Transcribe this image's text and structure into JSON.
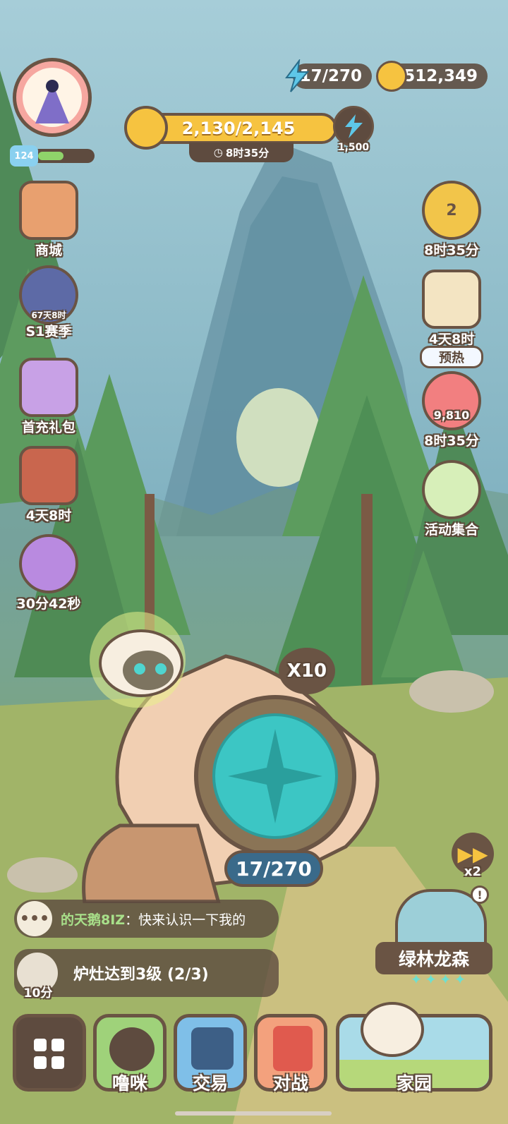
{
  "energy": {
    "value": "17/270"
  },
  "coins": {
    "value": "4,512,349"
  },
  "avatar": {
    "level": "124"
  },
  "progress": {
    "value": "2,130/2,145",
    "timer": "8时35分",
    "reward": "1,500",
    "fill_fraction": 0.993
  },
  "xp": {
    "fill_fraction": 0.45
  },
  "left_menu": [
    {
      "label": "商城",
      "sub": ""
    },
    {
      "label": "S1赛季",
      "sub": "67天8时"
    },
    {
      "label": "首充礼包",
      "sub": ""
    },
    {
      "label": "4天8时",
      "sub": ""
    },
    {
      "label": "30分42秒",
      "sub": ""
    }
  ],
  "right_menu": [
    {
      "label": "8时35分",
      "badge": "2"
    },
    {
      "label": "4天8时"
    },
    {
      "label": "8时35分",
      "tag": "预热",
      "value": "9,810"
    },
    {
      "label": "活动集合"
    }
  ],
  "dice": {
    "multiplier": "X10",
    "count": "17/270"
  },
  "speed": {
    "label": "x2"
  },
  "chat": {
    "name": "的天鹅8IZ",
    "text": "：快来认识一下我的"
  },
  "task": {
    "timer": "10分",
    "text": "炉灶达到3级 (2/3)"
  },
  "location": {
    "name": "绿林龙森"
  },
  "bottom_nav": [
    {
      "label": ""
    },
    {
      "label": "噜咪"
    },
    {
      "label": "交易"
    },
    {
      "label": "对战"
    },
    {
      "label": "家园"
    }
  ],
  "colors": {
    "panel": "#6a5444",
    "gold": "#f6c340",
    "energy": "#5ec7e8",
    "teal": "#39bfbf"
  }
}
